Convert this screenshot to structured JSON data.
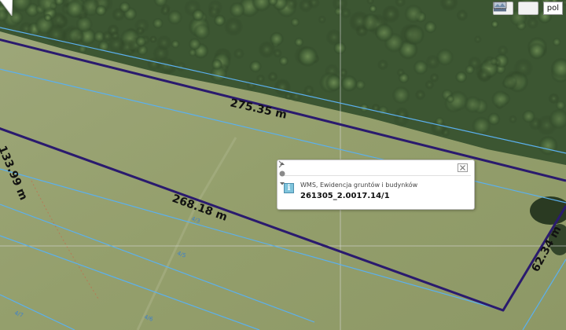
{
  "map": {
    "parcel_labels": [
      "4/3",
      "4/5",
      "4/6",
      "4/7"
    ],
    "dimensions": {
      "top_edge": "275.35 m",
      "bottom_edge": "268.18 m",
      "left_edge": "133.99 m",
      "right_edge": "62.34 m"
    },
    "colors": {
      "parcel_outline": "#2a1a6e",
      "cadastral_lines": "#4fa8e8",
      "grass": "#95a06d",
      "forest": "#2f4a2a"
    }
  },
  "toolbar": {
    "legend_icon": "legend-icon",
    "map_icon": "map-icon",
    "language": "pol"
  },
  "popup": {
    "layer_name": "WMS, Ewidencja gruntów i budynków",
    "parcel_id": "261305_2.0017.14/1",
    "icons": [
      "close-icon",
      "info-icon",
      "chevron-right-icon",
      "scroll-up-icon",
      "scroll-down-icon"
    ]
  }
}
